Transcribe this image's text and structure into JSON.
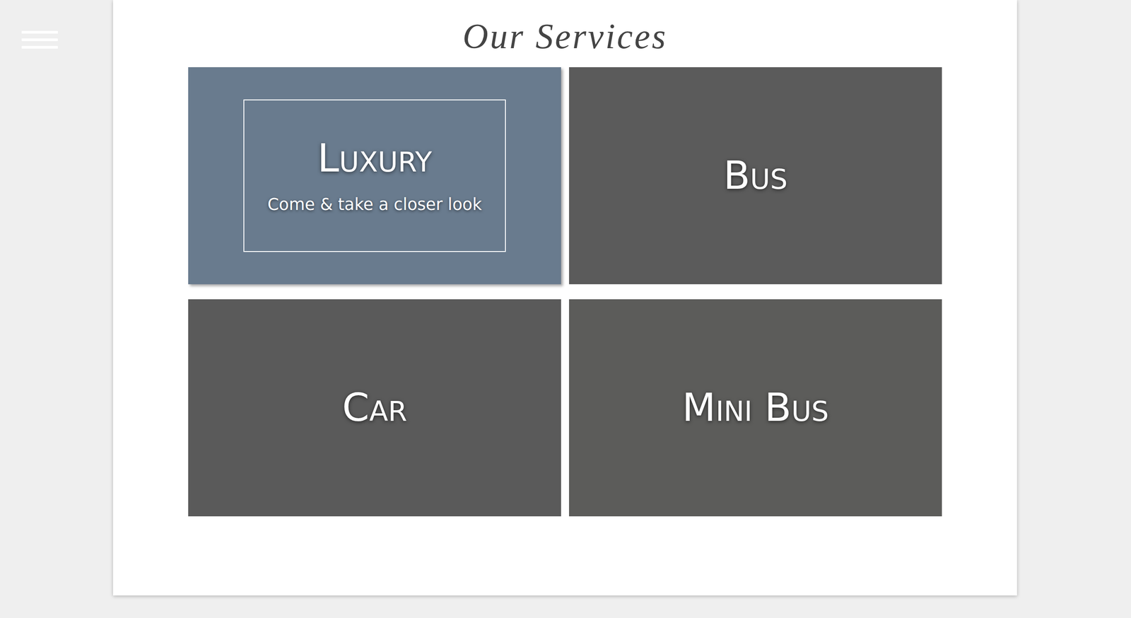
{
  "page": {
    "title": "Our Services"
  },
  "services": [
    {
      "label": "Luxury",
      "subtitle": "Come & take a closer look",
      "highlighted": true,
      "color": "#6f8296"
    },
    {
      "label": "Bus",
      "highlighted": false,
      "color": "#8c8c8c"
    },
    {
      "label": "Car",
      "highlighted": false,
      "color": "#8a8a8a"
    },
    {
      "label": "Mini Bus",
      "highlighted": false,
      "color": "#8e8e8a"
    }
  ]
}
